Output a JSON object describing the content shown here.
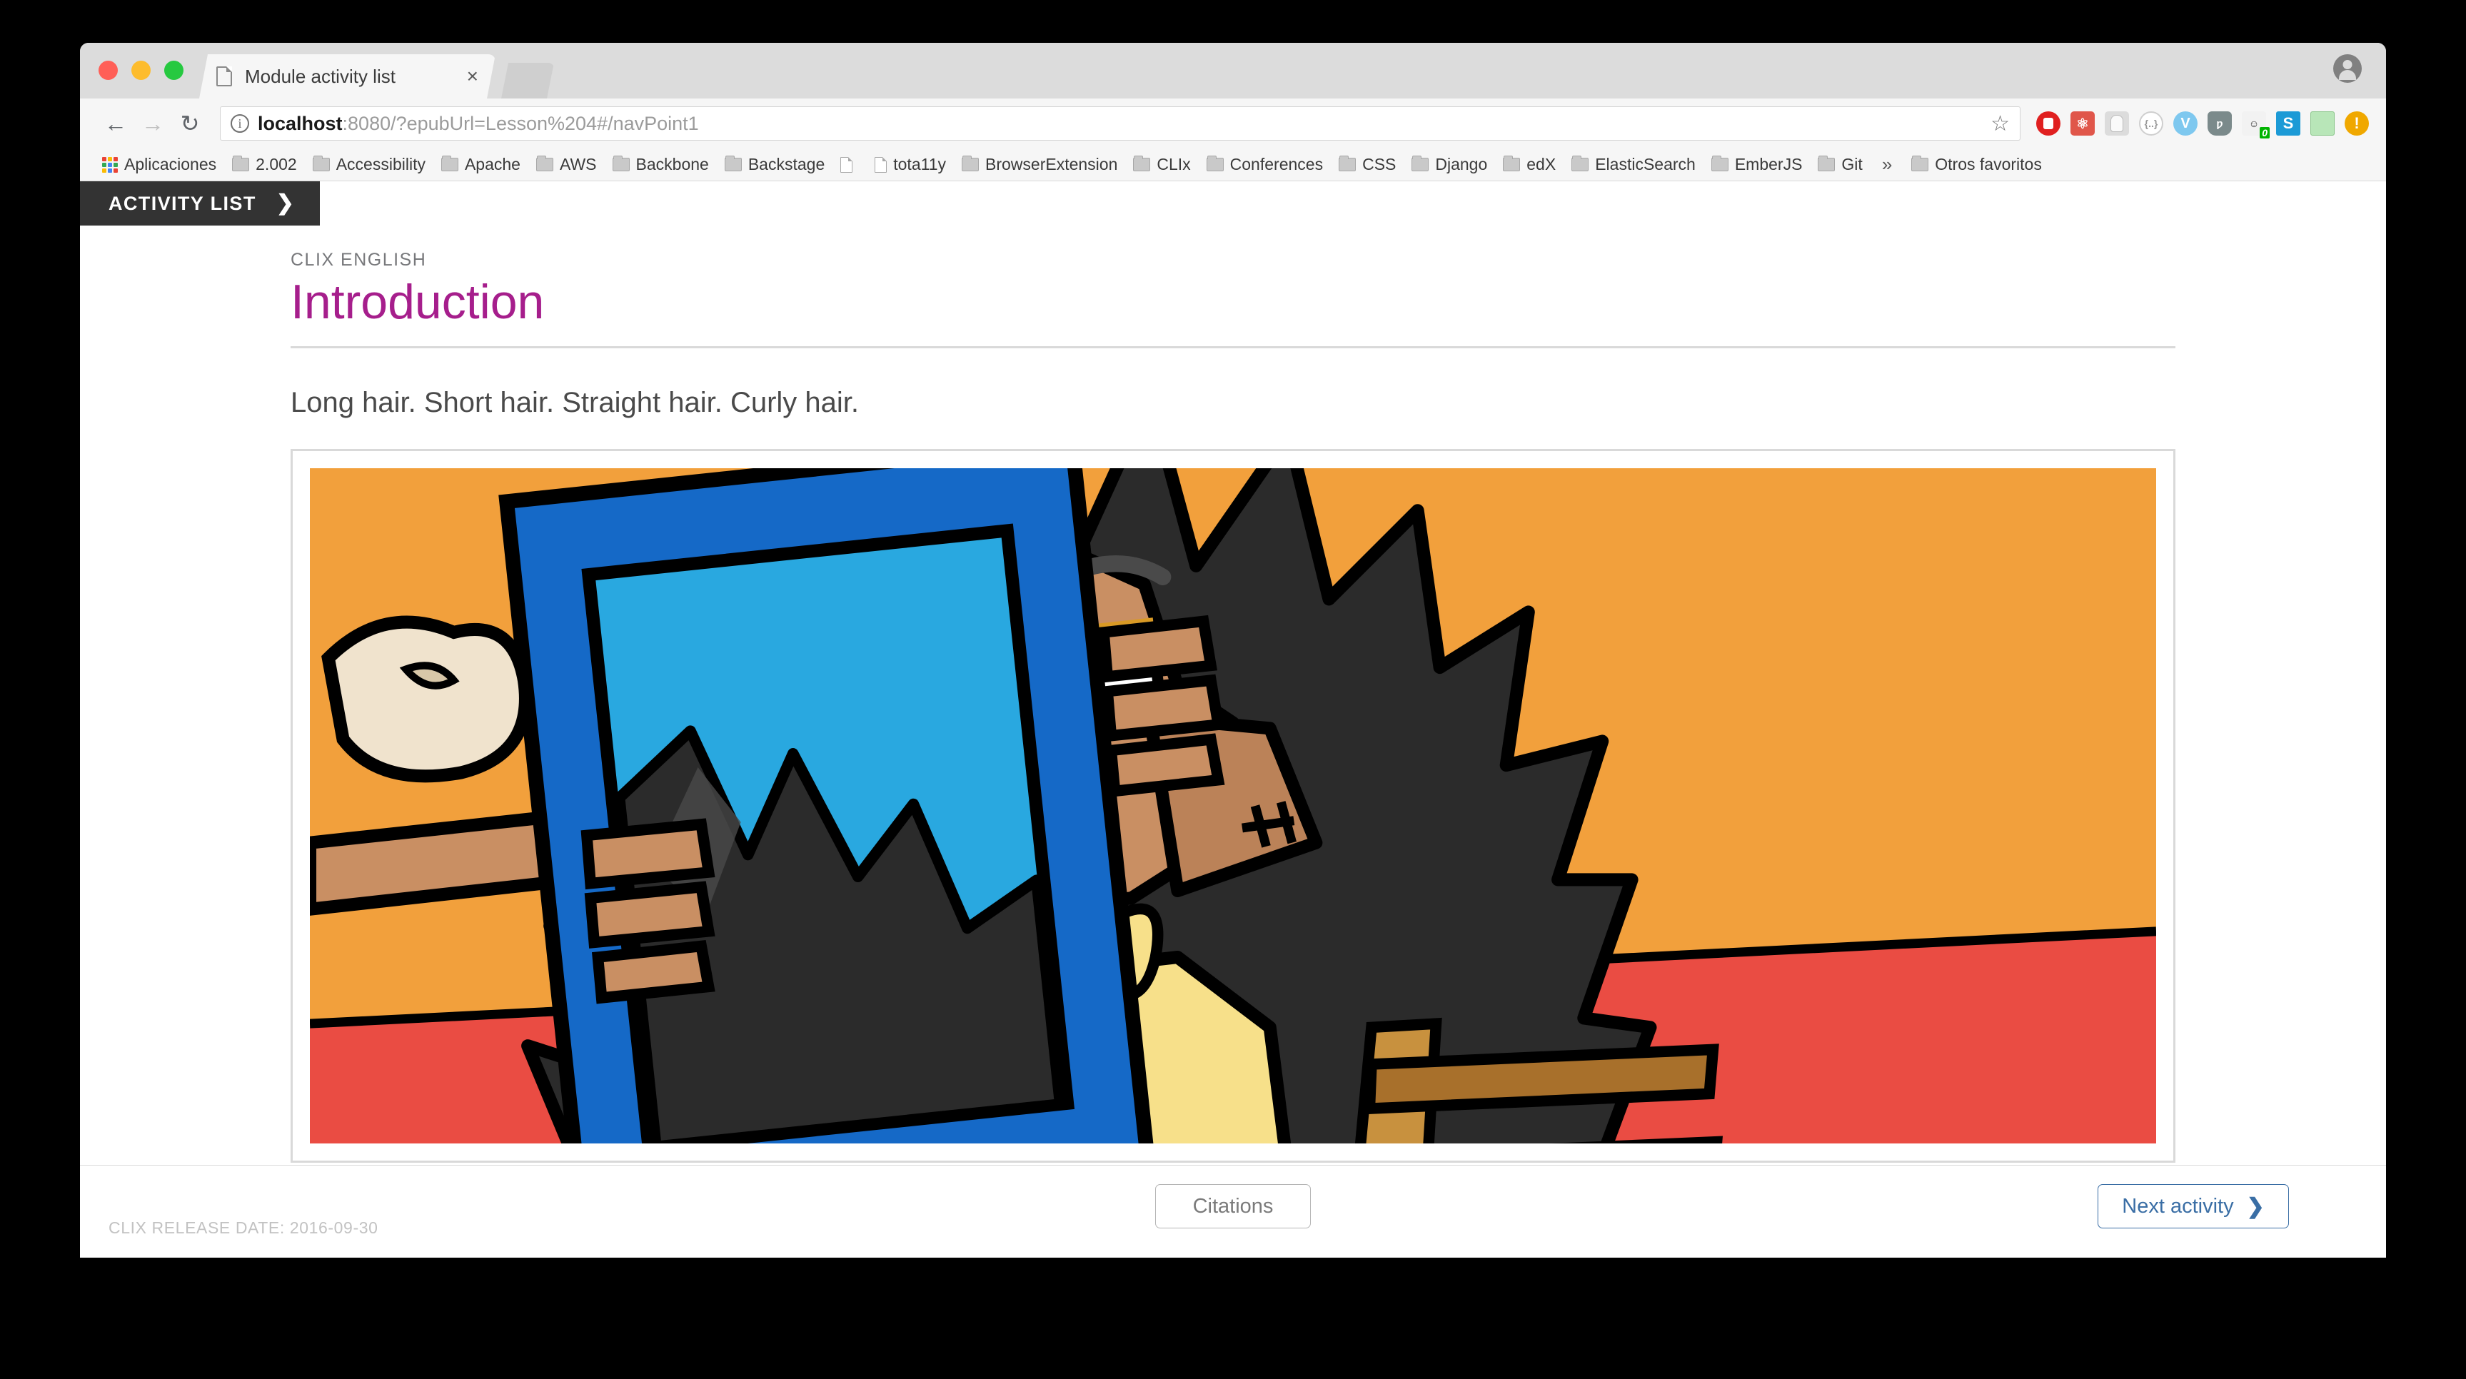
{
  "browser": {
    "tab": {
      "title": "Module activity list",
      "favicon": "page-icon",
      "close_label": "×"
    },
    "new_tab_label": "+",
    "toolbar": {
      "back": "←",
      "forward": "→",
      "reload": "↻",
      "info_icon": "ⓘ",
      "star_icon": "☆",
      "url_host": "localhost",
      "url_rest": ":8080/?epubUrl=Lesson%204#/navPoint1",
      "url_full": "localhost:8080/?epubUrl=Lesson%204#/navPoint1",
      "extensions": [
        {
          "name": "adblock-stop-icon",
          "glyph": "",
          "class": "ext-stop"
        },
        {
          "name": "react-devtools-icon",
          "glyph": "⚛",
          "class": "ext-react"
        },
        {
          "name": "ghostery-icon",
          "glyph": "",
          "class": "ext-ghost"
        },
        {
          "name": "json-formatter-icon",
          "glyph": "{..}",
          "class": "ext-json"
        },
        {
          "name": "vimium-icon",
          "glyph": "V",
          "class": "ext-blue"
        },
        {
          "name": "ublock-origin-icon",
          "glyph": "Ʊ",
          "class": "ext-ublock"
        },
        {
          "name": "privacy-badger-icon",
          "glyph": "🦡",
          "class": "ext-badger",
          "badge": "0"
        },
        {
          "name": "stylish-icon",
          "glyph": "S",
          "class": "ext-s"
        },
        {
          "name": "notes-list-icon",
          "glyph": "",
          "class": "ext-list"
        },
        {
          "name": "warning-icon",
          "glyph": "!",
          "class": "ext-warn"
        }
      ],
      "profile_icon": "account-avatar-icon"
    },
    "bookmarks": [
      {
        "label": "Aplicaciones",
        "icon": "apps-grid"
      },
      {
        "label": "2.002",
        "icon": "folder"
      },
      {
        "label": "Accessibility",
        "icon": "folder"
      },
      {
        "label": "Apache",
        "icon": "folder"
      },
      {
        "label": "AWS",
        "icon": "folder"
      },
      {
        "label": "Backbone",
        "icon": "folder"
      },
      {
        "label": "Backstage",
        "icon": "folder"
      },
      {
        "label": "",
        "icon": "page"
      },
      {
        "label": "tota11y",
        "icon": "page"
      },
      {
        "label": "BrowserExtension",
        "icon": "folder"
      },
      {
        "label": "CLIx",
        "icon": "folder"
      },
      {
        "label": "Conferences",
        "icon": "folder"
      },
      {
        "label": "CSS",
        "icon": "folder"
      },
      {
        "label": "Django",
        "icon": "folder"
      },
      {
        "label": "edX",
        "icon": "folder"
      },
      {
        "label": "ElasticSearch",
        "icon": "folder"
      },
      {
        "label": "EmberJS",
        "icon": "folder"
      },
      {
        "label": "Git",
        "icon": "folder"
      }
    ],
    "bookmarks_overflow": "»",
    "other_bookmarks": {
      "label": "Otros favoritos",
      "icon": "folder"
    }
  },
  "app": {
    "activity_bar": {
      "label": "ACTIVITY LIST",
      "chevron": "❯"
    },
    "eyebrow": "CLIX ENGLISH",
    "title": "Introduction",
    "lede": "Long hair. Short hair. Straight hair. Curly hair.",
    "figure": {
      "alt": "Cartoon illustration of a girl with long black spiky hair holding up a blue-framed mirror, seated on a wooden chair against an orange wall with a yellow band above and a red floor below.",
      "colors": {
        "yellow_band": "#FCC60A",
        "wall_orange": "#F2A03C",
        "floor_red": "#EA4C43",
        "mirror_frame": "#1569C7",
        "mirror_glass": "#29A8E0",
        "hair_black": "#2B2B2B",
        "skin": "#C98F63",
        "dress_yellow": "#F7E08A",
        "chair_brown": "#C8913E",
        "outline": "#000000"
      }
    },
    "footer": {
      "citations_label": "Citations",
      "next_label": "Next activity",
      "next_chevron": "❯",
      "release_date": "CLIX RELEASE DATE: 2016-09-30"
    }
  }
}
